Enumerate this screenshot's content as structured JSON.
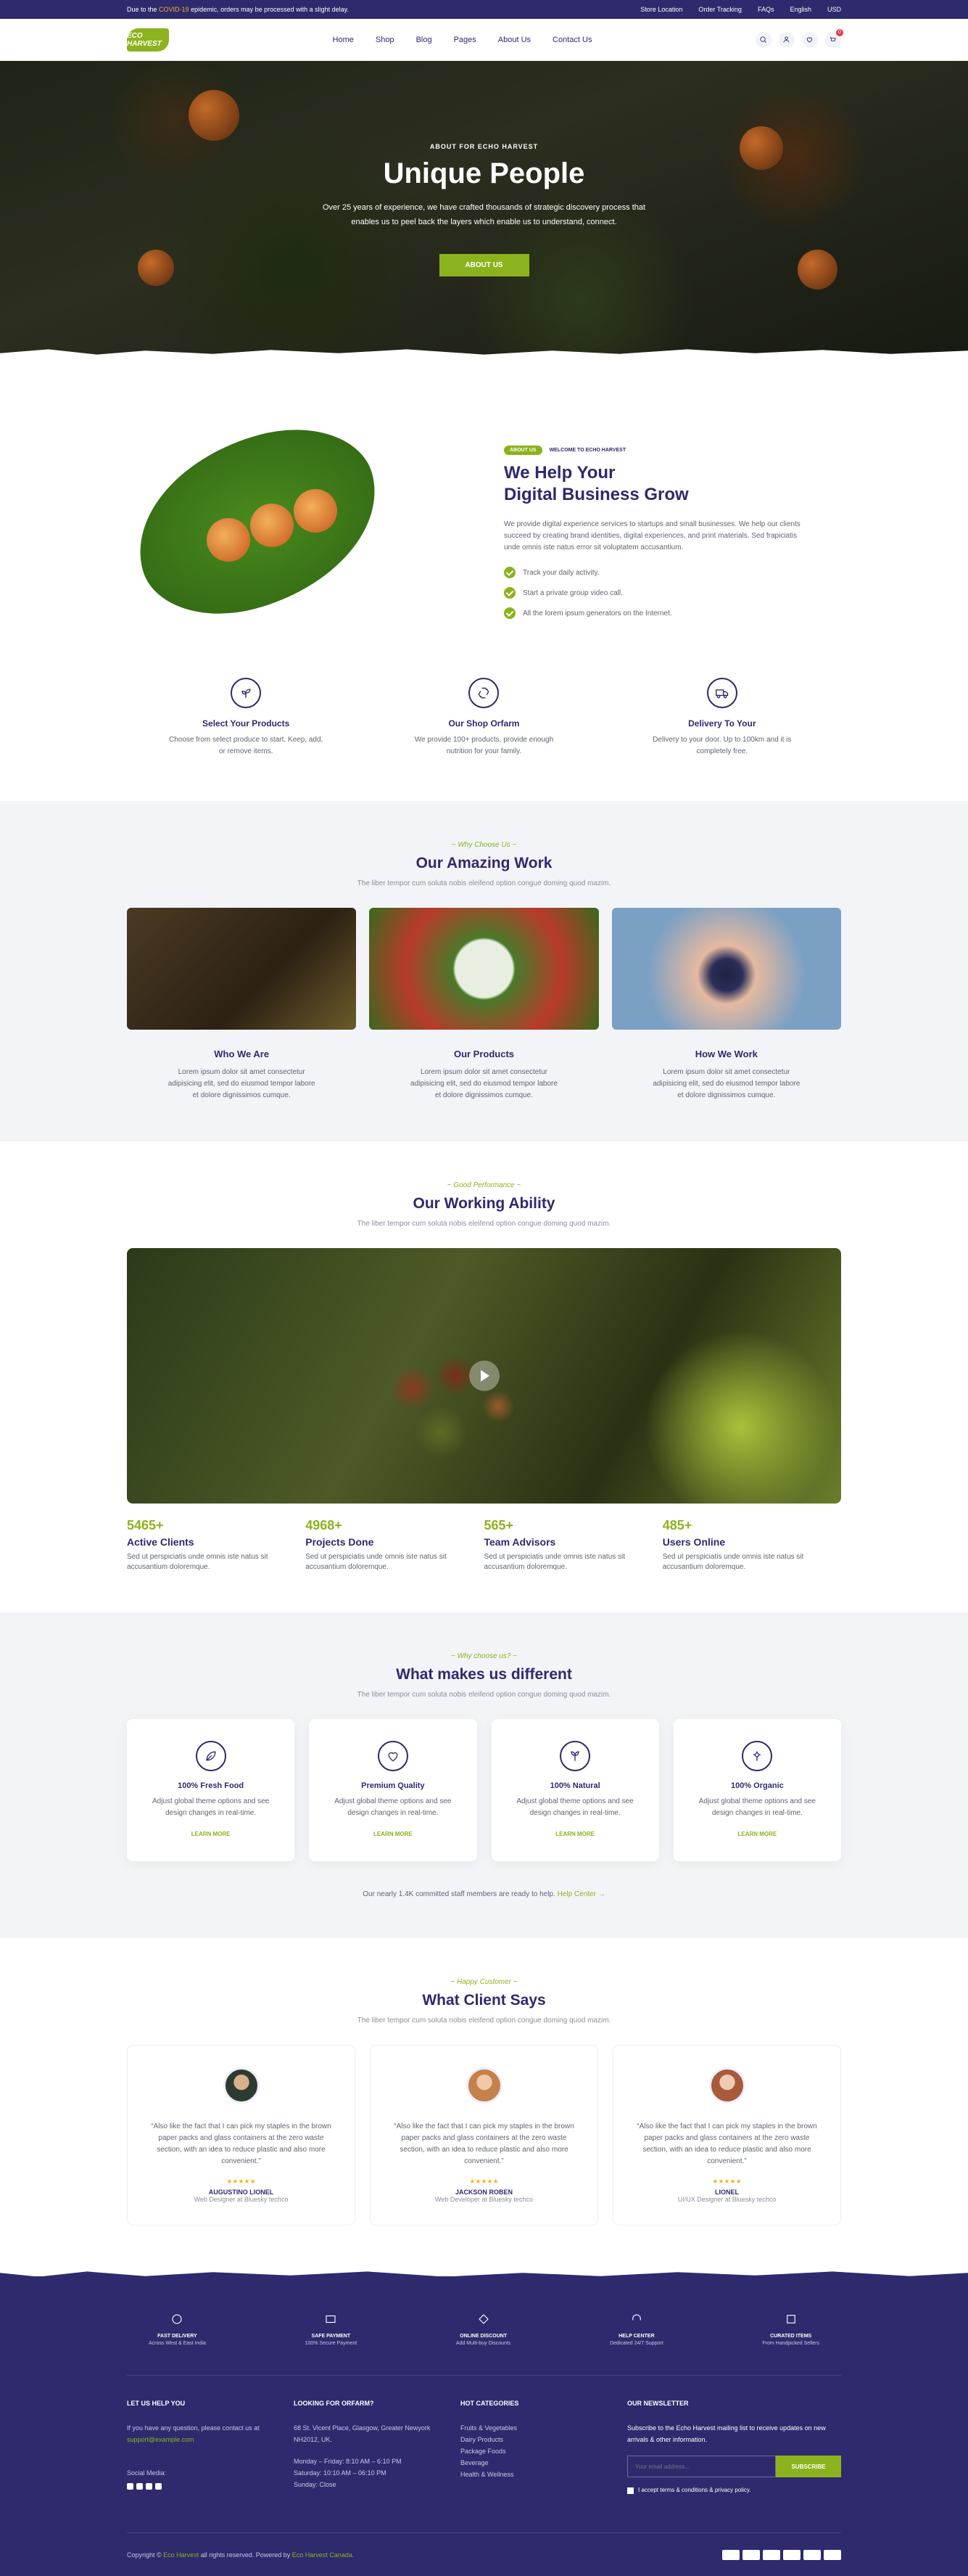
{
  "topbar": {
    "notice_prefix": "Due to the",
    "notice_highlight": "COVID-19",
    "notice_suffix": "epidemic, orders may be processed with a slight delay.",
    "links": [
      "Store Location",
      "Order Tracking",
      "FAQs"
    ],
    "language": "English",
    "currency": "USD"
  },
  "header": {
    "logo": "ECO HARVEST",
    "nav": [
      "Home",
      "Shop",
      "Blog",
      "Pages",
      "About Us",
      "Contact Us"
    ],
    "cart_count": "0"
  },
  "hero": {
    "kicker": "ABOUT FOR ECHO HARVEST",
    "title": "Unique People",
    "text": "Over 25 years of experience, we have crafted thousands of strategic discovery process that enables us to peel back the layers which enable us to understand, connect.",
    "button": "ABOUT US"
  },
  "about": {
    "pill": "ABOUT US",
    "tag": "WELCOME TO ECHO HARVEST",
    "title_1": "We Help Your",
    "title_2": "Digital Business Grow",
    "text": "We provide digital experience services to startups and small businesses. We help our clients succeed by creating brand identities, digital experiences, and print materials. Sed frapiciatis unde omnis iste natus error sit voluptatem accusantium.",
    "checks": [
      "Track your daily activity.",
      "Start a private group video call.",
      "All the lorem ipsum generators on the Internet."
    ]
  },
  "features": [
    {
      "icon": "plant-icon",
      "title": "Select Your Products",
      "text": "Choose from select produce to start. Keep, add, or remove items."
    },
    {
      "icon": "recycle-icon",
      "title": "Our Shop Orfarm",
      "text": "We provide 100+ products, provide enough nutrition for your family."
    },
    {
      "icon": "truck-icon",
      "title": "Delivery To Your",
      "text": "Delivery to your door. Up to 100km and it is completely free."
    }
  ],
  "work": {
    "kicker": "~ Why Choose Us ~",
    "title": "Our Amazing Work",
    "sub": "The liber tempor cum soluta nobis eleifend option congue doming quod mazim.",
    "cards": [
      {
        "title": "Who We Are",
        "text": "Lorem ipsum dolor sit amet consectetur adipisicing elit, sed do eiusmod tempor labore et dolore dignissimos cumque."
      },
      {
        "title": "Our Products",
        "text": "Lorem ipsum dolor sit amet consectetur adipisicing elit, sed do eiusmod tempor labore et dolore dignissimos cumque."
      },
      {
        "title": "How We Work",
        "text": "Lorem ipsum dolor sit amet consectetur adipisicing elit, sed do eiusmod tempor labore et dolore dignissimos cumque."
      }
    ]
  },
  "ability": {
    "kicker": "~ Good Performance ~",
    "title": "Our Working Ability",
    "sub": "The liber tempor cum soluta nobis eleifend option congue doming quod mazim.",
    "stats": [
      {
        "num": "5465+",
        "title": "Active Clients",
        "text": "Sed ut perspiciatis unde omnis iste natus sit accusantium doloremque."
      },
      {
        "num": "4968+",
        "title": "Projects Done",
        "text": "Sed ut perspiciatis unde omnis iste natus sit accusantium doloremque."
      },
      {
        "num": "565+",
        "title": "Team Advisors",
        "text": "Sed ut perspiciatis unde omnis iste natus sit accusantium doloremque."
      },
      {
        "num": "485+",
        "title": "Users Online",
        "text": "Sed ut perspiciatis unde omnis iste natus sit accusantium doloremque."
      }
    ]
  },
  "different": {
    "kicker": "~ Why choose us? ~",
    "title": "What makes us different",
    "sub": "The liber tempor cum soluta nobis eleifend option congue doming quod mazim.",
    "cards": [
      {
        "icon": "leaf-icon",
        "title": "100% Fresh Food",
        "text": "Adjust global theme options and see design changes in real-time.",
        "link": "LEARN MORE"
      },
      {
        "icon": "heart-icon",
        "title": "Premium Quality",
        "text": "Adjust global theme options and see design changes in real-time.",
        "link": "LEARN MORE"
      },
      {
        "icon": "sprout-icon",
        "title": "100% Natural",
        "text": "Adjust global theme options and see design changes in real-time.",
        "link": "LEARN MORE"
      },
      {
        "icon": "flower-icon",
        "title": "100% Organic",
        "text": "Adjust global theme options and see design changes in real-time.",
        "link": "LEARN MORE"
      }
    ],
    "staff_text": "Our nearly 1.4K committed staff members are ready to help.",
    "staff_link": "Help Center →"
  },
  "clients": {
    "kicker": "~ Happy Customer ~",
    "title": "What Client Says",
    "sub": "The liber tempor cum soluta nobis eleifend option congue doming quod mazim.",
    "items": [
      {
        "quote": "“Also like the fact that I can pick my staples in the brown paper packs and glass containers at the zero waste section, with an idea to reduce plastic and also more convenient.”",
        "name": "AUGUSTINO LIONEL",
        "role": "Web Designer at Bluesky techco"
      },
      {
        "quote": "“Also like the fact that I can pick my staples in the brown paper packs and glass containers at the zero waste section, with an idea to reduce plastic and also more convenient.”",
        "name": "JACKSON ROBEN",
        "role": "Web Developer at Bluesky techco"
      },
      {
        "quote": "“Also like the fact that I can pick my staples in the brown paper packs and glass containers at the zero waste section, with an idea to reduce plastic and also more convenient.”",
        "name": "LIONEL",
        "role": "UI/UX Designer at Bluesky techco"
      }
    ]
  },
  "footer": {
    "services": [
      {
        "title": "FAST DELIVERY",
        "text": "Across West & East India"
      },
      {
        "title": "SAFE PAYMENT",
        "text": "100% Secure Payment"
      },
      {
        "title": "ONLINE DISCOUNT",
        "text": "Add Multi-buy Discounts"
      },
      {
        "title": "HELP CENTER",
        "text": "Dedicated 24/7 Support"
      },
      {
        "title": "CURATED ITEMS",
        "text": "From Handpicked Sellers"
      }
    ],
    "help": {
      "title": "LET US HELP YOU",
      "text": "If you have any question, please contact us at",
      "email": "support@example.com",
      "social": "Social Media:"
    },
    "looking": {
      "title": "LOOKING FOR ORFARM?",
      "address": "68 St. Vicent Place, Glasgow, Greater Newyork NH2012, UK.",
      "hours_1": "Monday – Friday: 8:10 AM – 6:10 PM",
      "hours_2": "Saturday: 10:10 AM – 06:10 PM",
      "hours_3": "Sunday: Close"
    },
    "hot": {
      "title": "HOT CATEGORIES",
      "items": [
        "Fruits & Vegetables",
        "Dairy Products",
        "Package Foods",
        "Beverage",
        "Health & Wellness"
      ]
    },
    "newsletter": {
      "title": "OUR NEWSLETTER",
      "text": "Subscribe to the Echo Harvest mailing list to receive updates on new arrivals & other information.",
      "placeholder": "Your email address...",
      "button": "SUBSCRIBE",
      "agree": "I accept terms & conditions & privacy policy."
    },
    "copy_prefix": "Copyright ©",
    "copy_brand": "Eco Harvest",
    "copy_mid": "all rights reserved. Powered by",
    "copy_link": "Eco Harvest Canada."
  }
}
